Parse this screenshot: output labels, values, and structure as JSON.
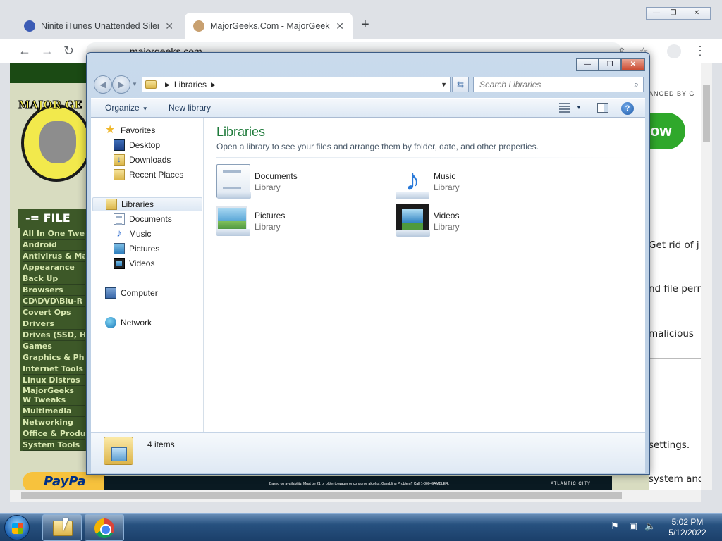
{
  "browser": {
    "tabs": [
      {
        "title": "Ninite iTunes Unattended Silent I",
        "close": "✕",
        "active": false
      },
      {
        "title": "MajorGeeks.Com - MajorGeeks",
        "close": "✕",
        "active": true
      }
    ],
    "new_tab": "+",
    "url": "majorgeeks.com",
    "window_controls": {
      "minimize": "—",
      "restore": "❐",
      "close": "✕"
    }
  },
  "website": {
    "logo_text": "MAJOR GE",
    "files_heading": "-= FILE",
    "categories": [
      "All In One Twe",
      "Android",
      "Antivirus & Ma",
      "Appearance",
      "Back Up",
      "Browsers",
      "CD\\DVD\\Blu-R",
      "Covert Ops",
      "Drivers",
      "Drives (SSD, H",
      "Games",
      "Graphics & Pho",
      "Internet Tools",
      "Linux Distros",
      "MajorGeeks W Tweaks",
      "Multimedia",
      "Networking",
      "Office & Produ",
      "System Tools"
    ],
    "enhanced_by": "ANCED BY G",
    "green_button": "ow",
    "snippets": [
      "Get rid of j",
      "nd file perr",
      "malicious",
      "settings.",
      "system and decry"
    ],
    "paypal": "PayPa",
    "ad_text": "Based on availability. Must be 21 or older to wager or consume alcohol. Gambling Problem? Call 1-800-GAMBLER.",
    "ad_brand": "ATLANTIC CITY"
  },
  "explorer": {
    "address": {
      "crumb": "Libraries"
    },
    "search_placeholder": "Search Libraries",
    "toolbar": {
      "organize": "Organize",
      "new_library": "New library"
    },
    "nav": {
      "favorites": "Favorites",
      "favorites_items": [
        "Desktop",
        "Downloads",
        "Recent Places"
      ],
      "libraries": "Libraries",
      "libraries_items": [
        "Documents",
        "Music",
        "Pictures",
        "Videos"
      ],
      "computer": "Computer",
      "network": "Network"
    },
    "content": {
      "title": "Libraries",
      "subtitle": "Open a library to see your files and arrange them by folder, date, and other properties.",
      "items": [
        {
          "name": "Documents",
          "type": "Library",
          "icon": "documents-library-icon"
        },
        {
          "name": "Music",
          "type": "Library",
          "icon": "music-library-icon"
        },
        {
          "name": "Pictures",
          "type": "Library",
          "icon": "pictures-library-icon"
        },
        {
          "name": "Videos",
          "type": "Library",
          "icon": "videos-library-icon"
        }
      ]
    },
    "details": {
      "count": "4 items"
    }
  },
  "taskbar": {
    "time": "5:02 PM",
    "date": "5/12/2022"
  }
}
